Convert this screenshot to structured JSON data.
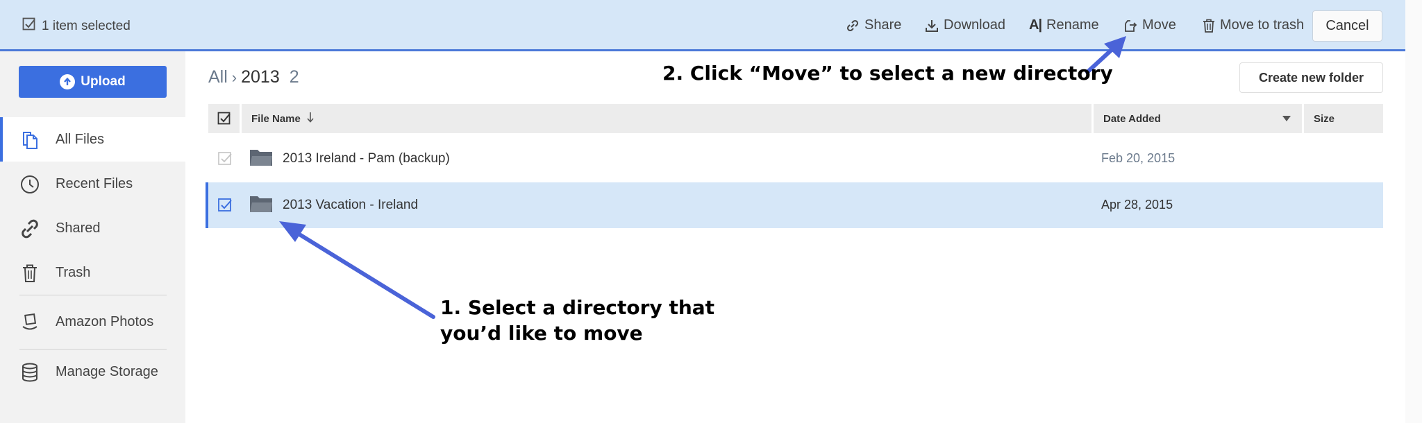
{
  "topbar": {
    "selection_text": "1 item selected",
    "actions": {
      "share": "Share",
      "download": "Download",
      "rename": "Rename",
      "rename_glyph": "A|",
      "move": "Move",
      "trash": "Move to trash"
    },
    "cancel": "Cancel"
  },
  "sidebar": {
    "upload": "Upload",
    "items": [
      {
        "label": "All Files",
        "icon": "files-icon",
        "active": true
      },
      {
        "label": "Recent Files",
        "icon": "clock-icon"
      },
      {
        "label": "Shared",
        "icon": "link-icon"
      },
      {
        "label": "Trash",
        "icon": "trash-icon"
      },
      {
        "label": "Amazon Photos",
        "icon": "photos-icon"
      },
      {
        "label": "Manage Storage",
        "icon": "database-icon"
      }
    ]
  },
  "breadcrumb": {
    "root": "All",
    "separator": "›",
    "current": "2013",
    "count": "2"
  },
  "create_folder": "Create new folder",
  "table": {
    "columns": {
      "name": "File Name",
      "date": "Date Added",
      "size": "Size"
    },
    "rows": [
      {
        "name": "2013 Ireland - Pam (backup)",
        "date": "Feb 20, 2015",
        "selected": false
      },
      {
        "name": "2013 Vacation - Ireland",
        "date": "Apr 28, 2015",
        "selected": true
      }
    ]
  },
  "annotations": {
    "step1_line1": "1. Select a directory that",
    "step1_line2": "you’d like to move",
    "step2": "2. Click “Move” to select a new directory"
  },
  "colors": {
    "accent": "#3b6fe0",
    "selection_bg": "#d6e7f8",
    "annotation_arrow": "#4a63d8"
  }
}
